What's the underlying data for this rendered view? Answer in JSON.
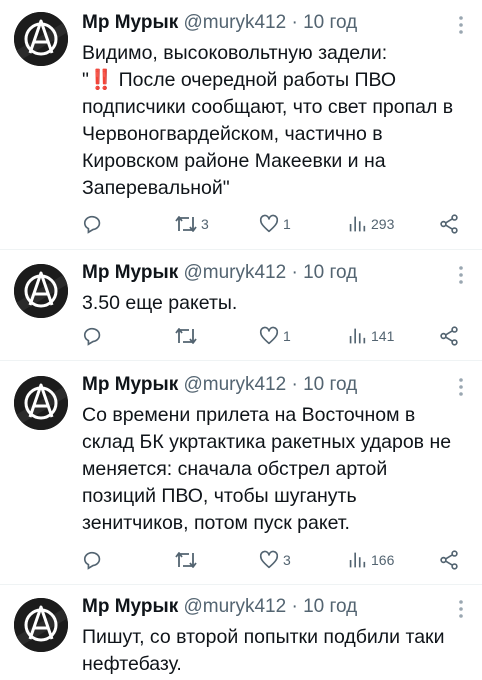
{
  "tweets": [
    {
      "author_name": "Мр Мурык",
      "handle": "@muryk412",
      "separator": "·",
      "time": "10 год",
      "text_prefix": "Видимо, высоковольтную задели:\n\"",
      "emoji": "‼️",
      "text_suffix": " После очередной работы ПВО подписчики сообщают, что свет пропал в Червоногвардейском, частично в Кировском районе Макеевки и на Заперевальной\"",
      "replies": "",
      "retweets": "3",
      "likes": "1",
      "views": "293"
    },
    {
      "author_name": "Мр Мурык",
      "handle": "@muryk412",
      "separator": "·",
      "time": "10 год",
      "text": "3.50 еще ракеты.",
      "replies": "",
      "retweets": "",
      "likes": "1",
      "views": "141"
    },
    {
      "author_name": "Мр Мурык",
      "handle": "@muryk412",
      "separator": "·",
      "time": "10 год",
      "text": "Со времени прилета на Восточном в склад БК укртактика ракетных ударов не меняется: сначала обстрел артой позиций ПВО, чтобы шугануть зенитчиков, потом пуск ракет.",
      "replies": "",
      "retweets": "",
      "likes": "3",
      "views": "166"
    },
    {
      "author_name": "Мр Мурык",
      "handle": "@muryk412",
      "separator": "·",
      "time": "10 год",
      "text": "Пишут, со второй попытки подбили таки нефтебазу."
    }
  ],
  "icons": {
    "avatar": "anarchy-symbol-avatar",
    "more": "more-vertical-icon",
    "reply": "reply-icon",
    "retweet": "retweet-icon",
    "like": "like-icon",
    "views": "views-icon",
    "share": "share-icon"
  },
  "colors": {
    "name": "#0f1419",
    "meta": "#536471",
    "emoji": "#e0182d",
    "divider": "#eff3f4"
  }
}
